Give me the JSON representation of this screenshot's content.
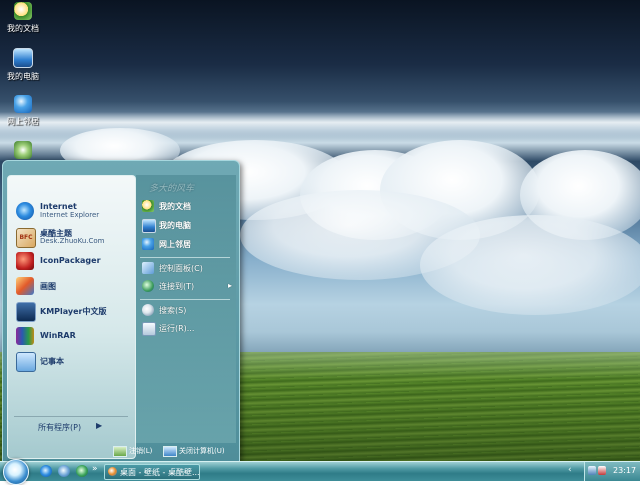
{
  "desktop_icons": [
    {
      "label": "我的文档",
      "icon": "my-documents-icon"
    },
    {
      "label": "我的电脑",
      "icon": "my-computer-icon"
    },
    {
      "label": "网上邻居",
      "icon": "network-places-icon"
    }
  ],
  "start_menu": {
    "pinned": [
      {
        "title": "Internet",
        "subtitle": "Internet Explorer",
        "icon": "internet-explorer-icon"
      },
      {
        "title": "桌酷主题",
        "subtitle": "Desk.ZhuoKu.Com",
        "icon": "zhuoku-theme-icon",
        "icon_text": "BFC"
      },
      {
        "title": "IconPackager",
        "icon": "iconpackager-icon"
      },
      {
        "title": "画图",
        "icon": "paint-icon"
      },
      {
        "title": "KMPlayer中文版",
        "icon": "kmplayer-icon"
      },
      {
        "title": "WinRAR",
        "icon": "winrar-icon"
      },
      {
        "title": "记事本",
        "icon": "notepad-icon"
      }
    ],
    "all_programs": "所有程序(P)",
    "right_links": [
      {
        "label": "我的文档",
        "icon": "my-documents-icon"
      },
      {
        "label": "我的电脑",
        "icon": "my-computer-icon"
      },
      {
        "label": "网上邻居",
        "icon": "network-places-icon"
      },
      {
        "label": "控制面板(C)",
        "icon": "control-panel-icon"
      },
      {
        "label": "连接到(T)",
        "icon": "connect-to-icon"
      },
      {
        "label": "搜索(S)",
        "icon": "search-icon"
      },
      {
        "label": "运行(R)...",
        "icon": "run-icon"
      }
    ],
    "logoff": "注销(L)",
    "shutdown": "关闭计算机(U)"
  },
  "taskbar": {
    "task_label": "桌面 - 壁纸 - 桌酷壁...",
    "clock": "23:17"
  },
  "colors": {
    "taskbar": "#3e8d98",
    "start_menu": "#5f9ea8",
    "menu_text": "#1d3b6b"
  }
}
